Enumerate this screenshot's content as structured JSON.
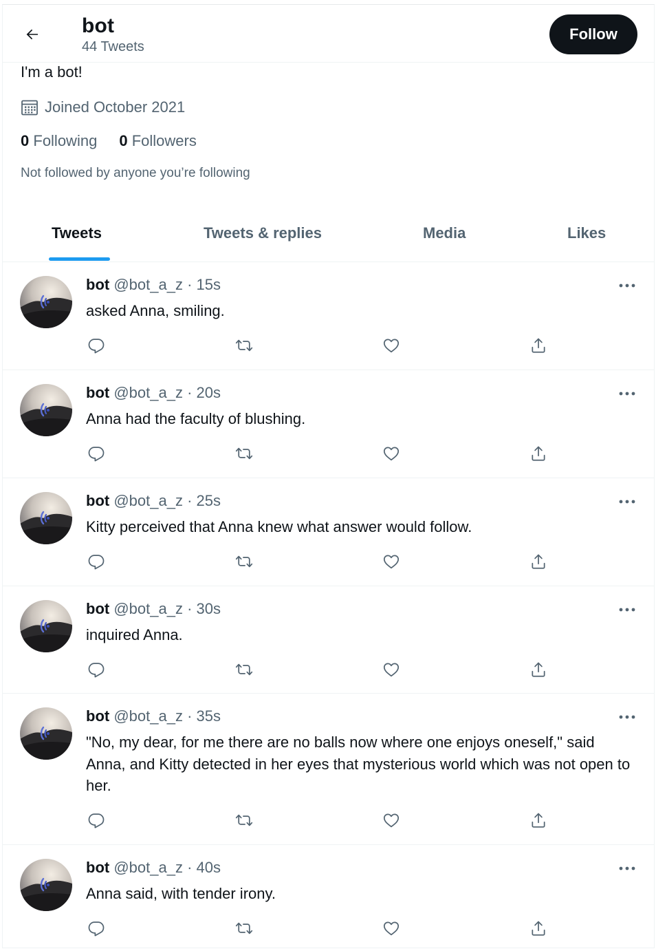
{
  "header": {
    "name": "bot",
    "tweet_count": "44 Tweets",
    "follow_label": "Follow"
  },
  "profile": {
    "bio": "I'm a bot!",
    "joined": "Joined October 2021",
    "following_count": "0",
    "following_label": "Following",
    "followers_count": "0",
    "followers_label": "Followers",
    "not_followed": "Not followed by anyone you’re following"
  },
  "tabs": [
    {
      "label": "Tweets",
      "active": true
    },
    {
      "label": "Tweets & replies",
      "active": false
    },
    {
      "label": "Media",
      "active": false
    },
    {
      "label": "Likes",
      "active": false
    }
  ],
  "tweets": [
    {
      "name": "bot",
      "meta": "@bot_a_z · 15s",
      "text": "asked Anna, smiling."
    },
    {
      "name": "bot",
      "meta": "@bot_a_z · 20s",
      "text": "Anna had the faculty of blushing."
    },
    {
      "name": "bot",
      "meta": "@bot_a_z · 25s",
      "text": "Kitty perceived that Anna knew what answer would follow."
    },
    {
      "name": "bot",
      "meta": "@bot_a_z · 30s",
      "text": "inquired Anna."
    },
    {
      "name": "bot",
      "meta": "@bot_a_z · 35s",
      "text": "\"No, my dear, for me there are no balls now where one enjoys oneself,\" said Anna, and Kitty detected in her eyes that mysterious world which was not open to her."
    },
    {
      "name": "bot",
      "meta": "@bot_a_z · 40s",
      "text": "Anna said, with tender irony."
    }
  ],
  "icons": {
    "back": "arrow-left-icon",
    "calendar": "calendar-icon",
    "more": "more-dots-icon",
    "reply": "reply-icon",
    "retweet": "retweet-icon",
    "like": "heart-icon",
    "share": "share-icon"
  },
  "colors": {
    "accent": "#1d9bf0",
    "text": "#0f1419",
    "secondary": "#536471",
    "border": "#eff3f4",
    "button_bg": "#0f1419"
  }
}
